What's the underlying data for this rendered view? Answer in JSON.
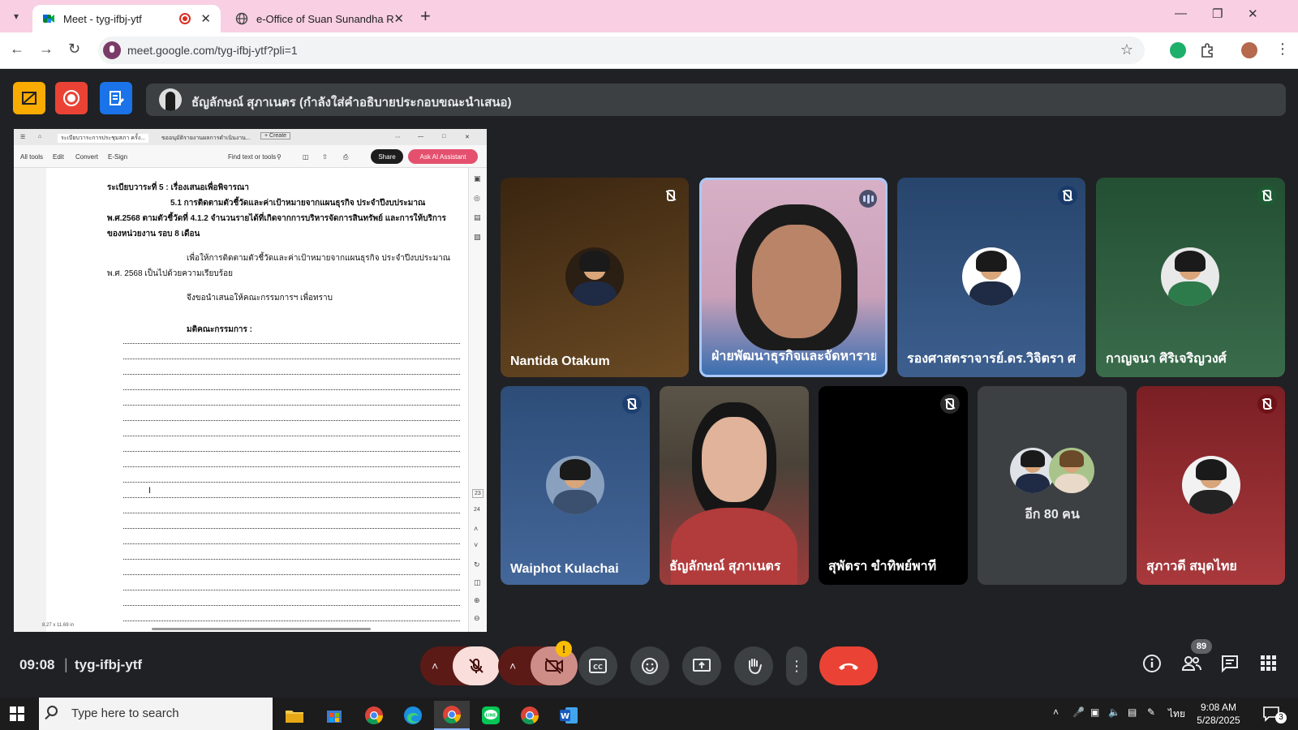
{
  "browser": {
    "tabs": [
      {
        "title": "Meet - tyg-ifbj-ytf",
        "recording": true
      },
      {
        "title": "e-Office of Suan Sunandha Rajabhat"
      }
    ],
    "url": "meet.google.com/tyg-ifbj-ytf?pli=1"
  },
  "banner": {
    "presenter_text": "ธัญลักษณ์ สุภาเนตร (กำลังใส่คำอธิบายประกอบขณะนำเสนอ)"
  },
  "shared_screen": {
    "tabs": [
      "ระเบียบวาระการประชุมสภา ครั้ง...",
      "ขออนุมัติรายงานผลการดำเนินงาน...",
      "+ Create"
    ],
    "toolbar": [
      "All tools",
      "Edit",
      "Convert",
      "E-Sign",
      "Find text or tools"
    ],
    "share_label": "Share",
    "ai_label": "Ask AI Assistant",
    "page_numbers": [
      "23",
      "24"
    ],
    "status": "8.27 x 11.69 in",
    "lines": [
      "ระเบียบวาระที่ 5  :  เรื่องเสนอเพื่อพิจารณา",
      "5.1  การติดตามตัวชี้วัดและค่าเป้าหมายจากแผนธุรกิจ ประจำปีงบประมาณ",
      "พ.ศ.2568 ตามตัวชี้วัดที่ 4.1.2 จำนวนรายได้ที่เกิดจากการบริหารจัดการสินทรัพย์ และการให้บริการ",
      "ของหน่วยงาน รอบ 8 เดือน",
      "เพื่อให้การติดตามตัวชี้วัดและค่าเป้าหมายจากแผนธุรกิจ ประจำปีงบประมาณ",
      "พ.ศ. 2568 เป็นไปด้วยความเรียบร้อย",
      "จึงขอนำเสนอให้คณะกรรมการฯ เพื่อทราบ",
      "มติคณะกรรมการ :"
    ]
  },
  "participants": [
    {
      "name": "Nantida Otakum",
      "bg": "#5a3a17",
      "muted": true
    },
    {
      "name": "ฝ่ายพัฒนาธุรกิจและจัดหาราย...",
      "bg": "#caa1b8",
      "speaking": true
    },
    {
      "name": "รองศาสตราจารย์.ดร.วิจิตรา ศ...",
      "bg": "#2f4b73",
      "muted": true
    },
    {
      "name": "กาญจนา ศิริเจริญวงศ์",
      "bg": "#2d5f3c",
      "muted": true
    },
    {
      "name": "Waiphot Kulachai",
      "bg": "#385a83",
      "muted": true
    },
    {
      "name": "ธัญลักษณ์ สุภาเนตร",
      "bg": "#8a3a3a"
    },
    {
      "name": "สุพัตรา ขำทิพย์พาที",
      "bg": "#000000",
      "muted": true
    },
    {
      "name": "อีก 80 คน",
      "bg": "#3c4043"
    },
    {
      "name": "สุภาวดี สมุดไทย",
      "bg": "#8e2a2a",
      "muted": true
    }
  ],
  "meeting": {
    "time": "09:08",
    "code": "tyg-ifbj-ytf",
    "participant_count": "89",
    "camera_warning": "!"
  },
  "taskbar": {
    "search_placeholder": "Type here to search",
    "time": "9:08 AM",
    "date": "5/28/2025",
    "language": "ไทย",
    "notifications": "3"
  }
}
